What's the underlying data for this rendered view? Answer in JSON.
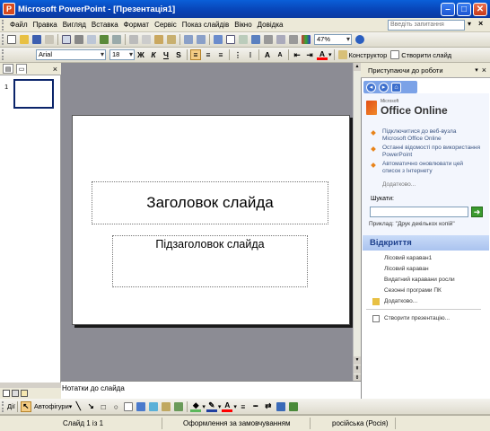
{
  "window": {
    "title": "Microsoft PowerPoint - [Презентація1]",
    "app_icon": "powerpoint-icon",
    "controls": [
      "minimize",
      "maximize",
      "close"
    ]
  },
  "menu": {
    "items": [
      "Файл",
      "Правка",
      "Вигляд",
      "Вставка",
      "Формат",
      "Сервіс",
      "Показ слайдів",
      "Вікно",
      "Довідка"
    ],
    "help_placeholder": "Введіть запитання"
  },
  "toolbar_standard": {
    "zoom": "47%",
    "icons": [
      "new-icon",
      "open-icon",
      "save-icon",
      "permission-icon",
      "email-icon",
      "print-icon",
      "print-preview-icon",
      "spelling-icon",
      "research-icon",
      "cut-icon",
      "copy-icon",
      "paste-icon",
      "format-painter-icon",
      "undo-icon",
      "redo-icon",
      "insert-chart-icon",
      "insert-table-icon",
      "tables-borders-icon",
      "hyperlink-icon",
      "expand-icon",
      "show-formatting-icon",
      "grid-icon",
      "color-grayscale-icon",
      "help-icon"
    ]
  },
  "toolbar_formatting": {
    "font": "Arial",
    "size": "18",
    "bold": "Ж",
    "italic": "К",
    "underline": "Ч",
    "shadow": "S",
    "design_label": "Конструктор",
    "new_slide_label": "Створити слайд",
    "font_color": "#ff0000"
  },
  "outline_tabs": [
    "outline-tab",
    "slides-tab"
  ],
  "thumbnail_number": "1",
  "slide": {
    "title": "Заголовок слайда",
    "subtitle": "Підзаголовок слайда"
  },
  "notes_placeholder": "Нотатки до слайда",
  "task_pane": {
    "header": "Приступаючи до роботи",
    "logo_small": "Microsoft",
    "logo_text": "Office Online",
    "links": [
      "Підключитися до веб-вузла Microsoft Office Online",
      "Останні відомості про використання PowerPoint",
      "Автоматично оновлювати цей список з Інтернету"
    ],
    "more_link": "Додатково...",
    "search_label": "Шукати:",
    "search_value": "",
    "example": "Приклад: \"Друк декількох копій\"",
    "open_section": "Відкриття",
    "files": [
      "Лісовий караван1",
      "Лісовий караван",
      "Видатний каравани росли",
      "Сезонні програми ПК"
    ],
    "more_files": "Додатково...",
    "create_link": "Створити презентацію..."
  },
  "drawing_toolbar": {
    "draw_label": "Дії",
    "autoshapes_label": "Автофігури",
    "icons": [
      "line-icon",
      "arrow-icon",
      "rectangle-icon",
      "oval-icon",
      "textbox-icon",
      "wordart-icon",
      "diagram-icon",
      "clipart-icon",
      "picture-icon",
      "fill-color-icon",
      "line-color-icon",
      "font-color-icon",
      "line-style-icon",
      "dash-style-icon",
      "arrow-style-icon",
      "shadow-icon",
      "3d-icon"
    ]
  },
  "status_bar": {
    "slide_info": "Слайд 1 із 1",
    "design": "Оформлення за замовчуванням",
    "language": "російська (Росія)"
  },
  "colors": {
    "title_bar": "#0842b5",
    "slide_area": "#8c8c94",
    "open_header": "#aac3ef",
    "accent_bullet": "#e8841a"
  }
}
